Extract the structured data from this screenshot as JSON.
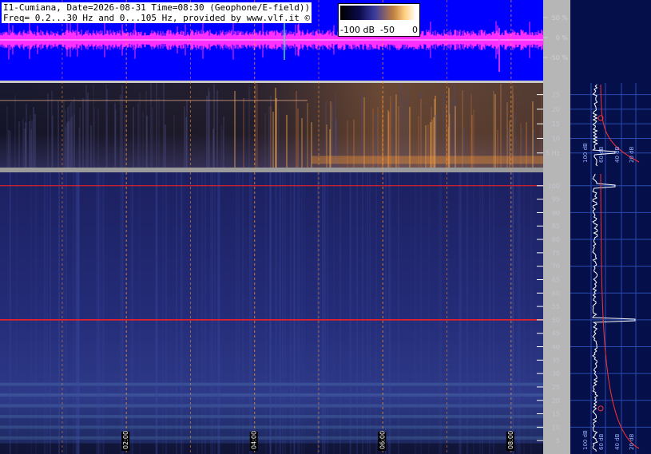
{
  "header": {
    "line1": "I1-Cumiana, Date=2026-08-31 Time=08:30 (Geophone/E-field))",
    "line2": "Freq= 0.2...30 Hz and 0...105 Hz, provided by www.vlf.it ©"
  },
  "scale": {
    "labels": [
      "-100 dB",
      "-50",
      "0"
    ]
  },
  "colors": {
    "waveform_bg": "#0000ff",
    "waveform_trace": "#ff30ff",
    "spectrogram_bg": "#15153a",
    "grid_lines": "#ff9a30",
    "mains_line": "#ff2020",
    "spectrum_curve": "#ff3030",
    "spectrum_trace": "#ffffff",
    "side_panel_bg": "#05104a"
  },
  "chart_data": [
    {
      "type": "line",
      "name": "waveform",
      "y_ticks": [
        "50 %",
        "0 %",
        "-50 %"
      ]
    },
    {
      "type": "heatmap",
      "name": "spectrogram_low",
      "y_ticks": [
        {
          "value": 25,
          "label": "25"
        },
        {
          "value": 20,
          "label": "20"
        },
        {
          "value": 15,
          "label": "15"
        },
        {
          "value": 10,
          "label": "10"
        },
        {
          "value": 5,
          "label": "5 Hz"
        }
      ],
      "ylim": [
        0,
        29
      ],
      "x_time_labels": [
        {
          "hour": 2,
          "label": "02:00"
        },
        {
          "hour": 4,
          "label": "04:00"
        },
        {
          "hour": 6,
          "label": "06:00"
        },
        {
          "hour": 8,
          "label": "08:00"
        }
      ],
      "xlim_hours": [
        0.03,
        8.5
      ]
    },
    {
      "type": "heatmap",
      "name": "spectrogram_high",
      "y_ticks": [
        {
          "value": 100,
          "label": "100"
        },
        {
          "value": 95,
          "label": "95"
        },
        {
          "value": 90,
          "label": "90"
        },
        {
          "value": 85,
          "label": "85"
        },
        {
          "value": 80,
          "label": "80"
        },
        {
          "value": 75,
          "label": "75"
        },
        {
          "value": 70,
          "label": "70"
        },
        {
          "value": 65,
          "label": "65"
        },
        {
          "value": 60,
          "label": "60"
        },
        {
          "value": 55,
          "label": "55"
        },
        {
          "value": 50,
          "label": "50"
        },
        {
          "value": 45,
          "label": "45"
        },
        {
          "value": 40,
          "label": "40"
        },
        {
          "value": 35,
          "label": "35"
        },
        {
          "value": 30,
          "label": "30"
        },
        {
          "value": 25,
          "label": "25"
        },
        {
          "value": 20,
          "label": "20"
        },
        {
          "value": 15,
          "label": "15"
        },
        {
          "value": 10,
          "label": "10"
        },
        {
          "value": 5,
          "label": "5"
        }
      ],
      "ylim": [
        0,
        105
      ],
      "mains_hz": 50,
      "marker_hz": 100
    },
    {
      "type": "line",
      "name": "spectrum_upper",
      "db_labels": [
        "100 dB",
        "60 dB",
        "40 dB",
        "20 dB"
      ]
    },
    {
      "type": "line",
      "name": "spectrum_lower",
      "db_labels": [
        "100 dB",
        "60 dB",
        "40 dB",
        "20 dB"
      ]
    }
  ]
}
